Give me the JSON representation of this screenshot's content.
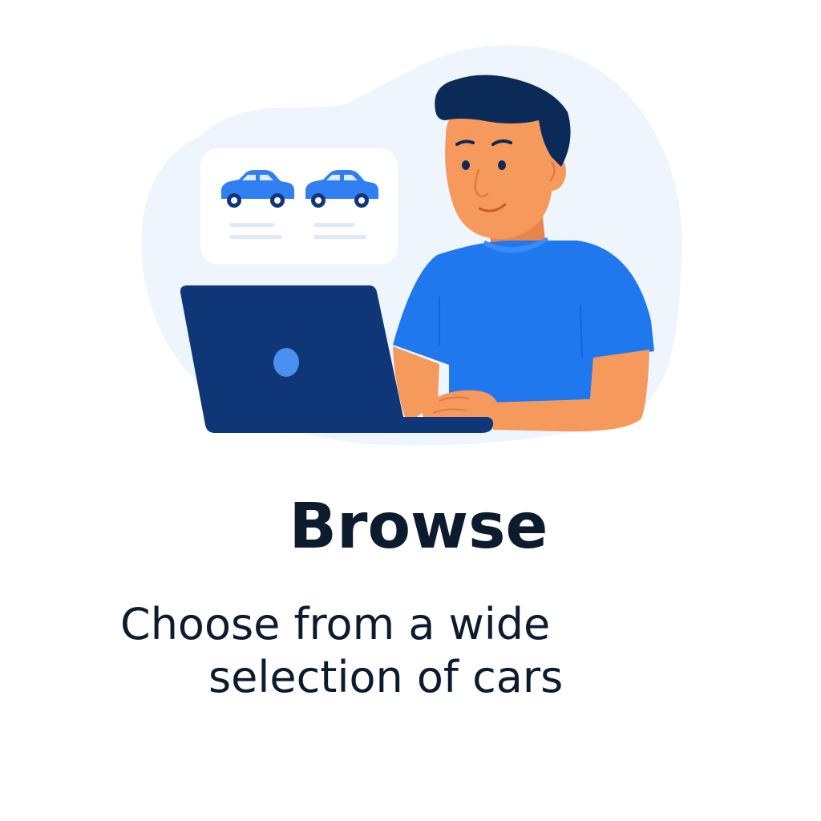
{
  "heading": "Browse",
  "description": {
    "line_1": "Choose from a wide",
    "line_2": "selection of cars"
  },
  "illustration": {
    "icons": [
      "car-icon",
      "car-icon",
      "laptop-icon"
    ],
    "colors": {
      "background_blob": "#eef5fc",
      "card": "#ffffff",
      "car_blue": "#2f7ff0",
      "laptop_navy": "#0f3778",
      "laptop_dot": "#4a90f0",
      "shirt_blue": "#1f78ee",
      "skin": "#f59a5c",
      "hair": "#0c2a57",
      "text_dark": "#0d1b2e"
    }
  }
}
